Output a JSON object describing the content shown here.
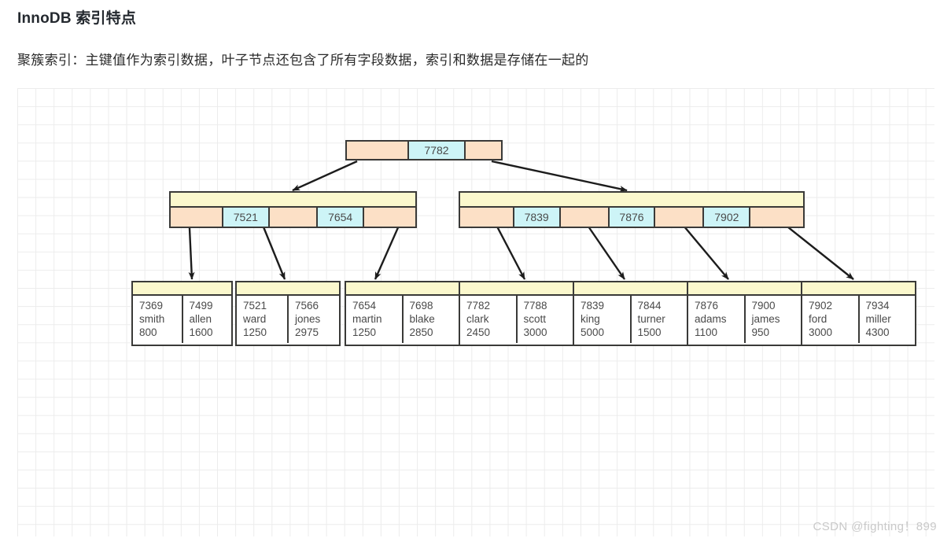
{
  "page": {
    "title": "InnoDB 索引特点",
    "description": "聚簇索引：主键值作为索引数据，叶子节点还包含了所有字段数据，索引和数据是存储在一起的",
    "watermark": "CSDN @fighting！899"
  },
  "colors": {
    "pointer_cell": "#fce0c6",
    "key_cell": "#cdf4f7",
    "header_cell": "#fbf8cd",
    "leaf_cell": "#ffffff",
    "border": "#3a3a38",
    "grid_line": "#ececec",
    "text": "#4a4a4a",
    "title_text": "#24292f",
    "watermark_text": "#c9c9c9"
  },
  "tree": {
    "root": {
      "cells": [
        {
          "type": "pointer",
          "label": ""
        },
        {
          "type": "key",
          "label": "7782"
        },
        {
          "type": "pointer",
          "label": ""
        }
      ]
    },
    "internal_nodes": [
      {
        "name": "internal-node-left",
        "cells": [
          {
            "type": "pointer",
            "label": ""
          },
          {
            "type": "key",
            "label": "7521"
          },
          {
            "type": "pointer",
            "label": ""
          },
          {
            "type": "key",
            "label": "7654"
          },
          {
            "type": "pointer",
            "label": ""
          }
        ]
      },
      {
        "name": "internal-node-right",
        "cells": [
          {
            "type": "pointer",
            "label": ""
          },
          {
            "type": "key",
            "label": "7839"
          },
          {
            "type": "pointer",
            "label": ""
          },
          {
            "type": "key",
            "label": "7876"
          },
          {
            "type": "pointer",
            "label": ""
          },
          {
            "type": "key",
            "label": "7902"
          },
          {
            "type": "pointer",
            "label": ""
          }
        ]
      }
    ],
    "leaf_nodes": [
      {
        "name": "leaf-node-1",
        "records": [
          {
            "id": "7369",
            "name": "smith",
            "salary": "800"
          },
          {
            "id": "7499",
            "name": "allen",
            "salary": "1600"
          }
        ]
      },
      {
        "name": "leaf-node-2",
        "records": [
          {
            "id": "7521",
            "name": "ward",
            "salary": "1250"
          },
          {
            "id": "7566",
            "name": "jones",
            "salary": "2975"
          }
        ]
      },
      {
        "name": "leaf-node-3",
        "records": [
          {
            "id": "7654",
            "name": "martin",
            "salary": "1250"
          },
          {
            "id": "7698",
            "name": "blake",
            "salary": "2850"
          }
        ]
      },
      {
        "name": "leaf-node-4",
        "records": [
          {
            "id": "7782",
            "name": "clark",
            "salary": "2450"
          },
          {
            "id": "7788",
            "name": "scott",
            "salary": "3000"
          }
        ]
      },
      {
        "name": "leaf-node-5",
        "records": [
          {
            "id": "7839",
            "name": "king",
            "salary": "5000"
          },
          {
            "id": "7844",
            "name": "turner",
            "salary": "1500"
          }
        ]
      },
      {
        "name": "leaf-node-6",
        "records": [
          {
            "id": "7876",
            "name": "adams",
            "salary": "1100"
          },
          {
            "id": "7900",
            "name": "james",
            "salary": "950"
          }
        ]
      },
      {
        "name": "leaf-node-7",
        "records": [
          {
            "id": "7902",
            "name": "ford",
            "salary": "3000"
          },
          {
            "id": "7934",
            "name": "miller",
            "salary": "4300"
          }
        ]
      }
    ]
  }
}
